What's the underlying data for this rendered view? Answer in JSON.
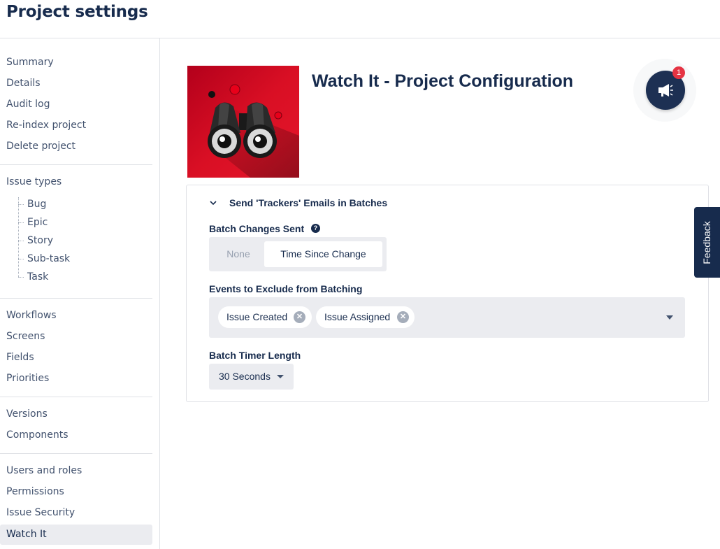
{
  "page": {
    "title": "Project settings"
  },
  "sidebar": {
    "group1": [
      "Summary",
      "Details",
      "Audit log",
      "Re-index project",
      "Delete project"
    ],
    "issue_types": {
      "label": "Issue types",
      "children": [
        "Bug",
        "Epic",
        "Story",
        "Sub-task",
        "Task"
      ]
    },
    "group3": [
      "Workflows",
      "Screens",
      "Fields",
      "Priorities"
    ],
    "group4": [
      "Versions",
      "Components"
    ],
    "group5": [
      "Users and roles",
      "Permissions",
      "Issue Security",
      "Watch It"
    ],
    "active": "Watch It"
  },
  "config": {
    "title": "Watch It - Project Configuration",
    "logo_icon": "binoculars-logo"
  },
  "announcements": {
    "icon": "megaphone-icon",
    "badge": "1"
  },
  "section": {
    "title": "Send 'Trackers' Emails in Batches",
    "batch_changes": {
      "label": "Batch Changes Sent",
      "help": "?",
      "options": [
        "None",
        "Time Since Change"
      ],
      "selected": "Time Since Change"
    },
    "exclude": {
      "label": "Events to Exclude from Batching",
      "chips": [
        "Issue Created",
        "Issue Assigned"
      ]
    },
    "timer": {
      "label": "Batch Timer Length",
      "value": "30 Seconds"
    }
  },
  "feedback": {
    "label": "Feedback"
  },
  "colors": {
    "accent": "#1d3053",
    "badge": "#e53343",
    "logo": "#d90f24"
  }
}
